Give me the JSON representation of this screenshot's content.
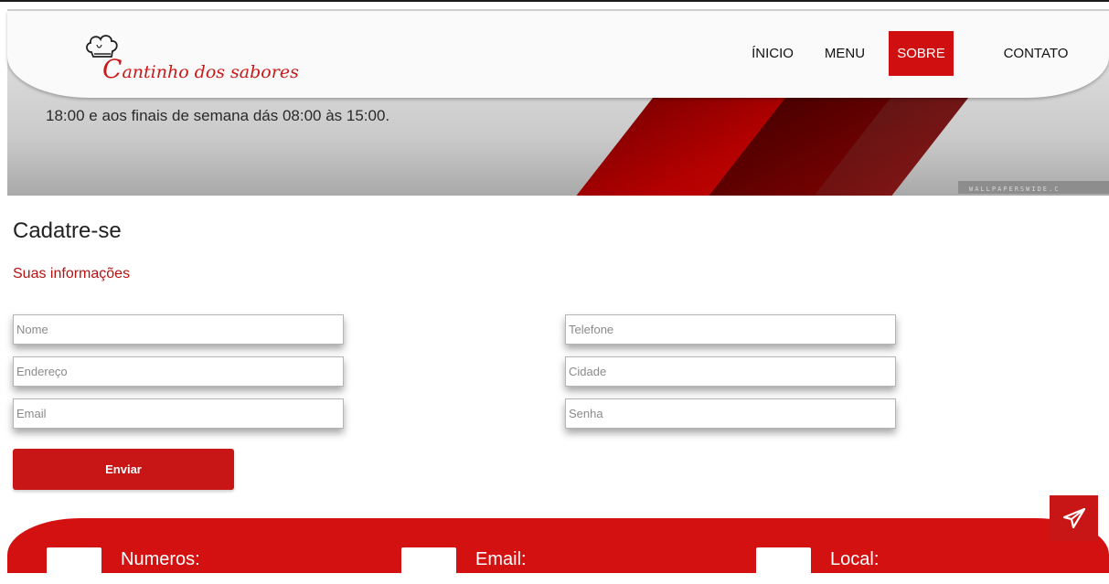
{
  "header": {
    "brand_initial": "C",
    "brand_rest": "antinho dos sabores",
    "nav": [
      {
        "label": "ÍNICIO",
        "active": false
      },
      {
        "label": "MENU",
        "active": false
      },
      {
        "label": "SOBRE",
        "active": true
      },
      {
        "label": "CONTATO",
        "active": false
      }
    ]
  },
  "hero": {
    "text": "18:00 e aos finais de semana dás 08:00 às 15:00.",
    "watermark": "WALLPAPERSWIDE.C"
  },
  "form": {
    "title": "Cadatre-se",
    "subtitle": "Suas informações",
    "fields": {
      "nome": "Nome",
      "endereco": "Endereço",
      "email": "Email",
      "telefone": "Telefone",
      "cidade": "Cidade",
      "senha": "Senha"
    },
    "submit_label": "Enviar"
  },
  "footer": {
    "items": [
      "Numeros:",
      "Email:",
      "Local:"
    ]
  },
  "colors": {
    "accent": "#d01010",
    "subtitle": "#b51212"
  },
  "icons": {
    "logo": "chef-hat-icon",
    "floating": "paper-plane-icon"
  }
}
